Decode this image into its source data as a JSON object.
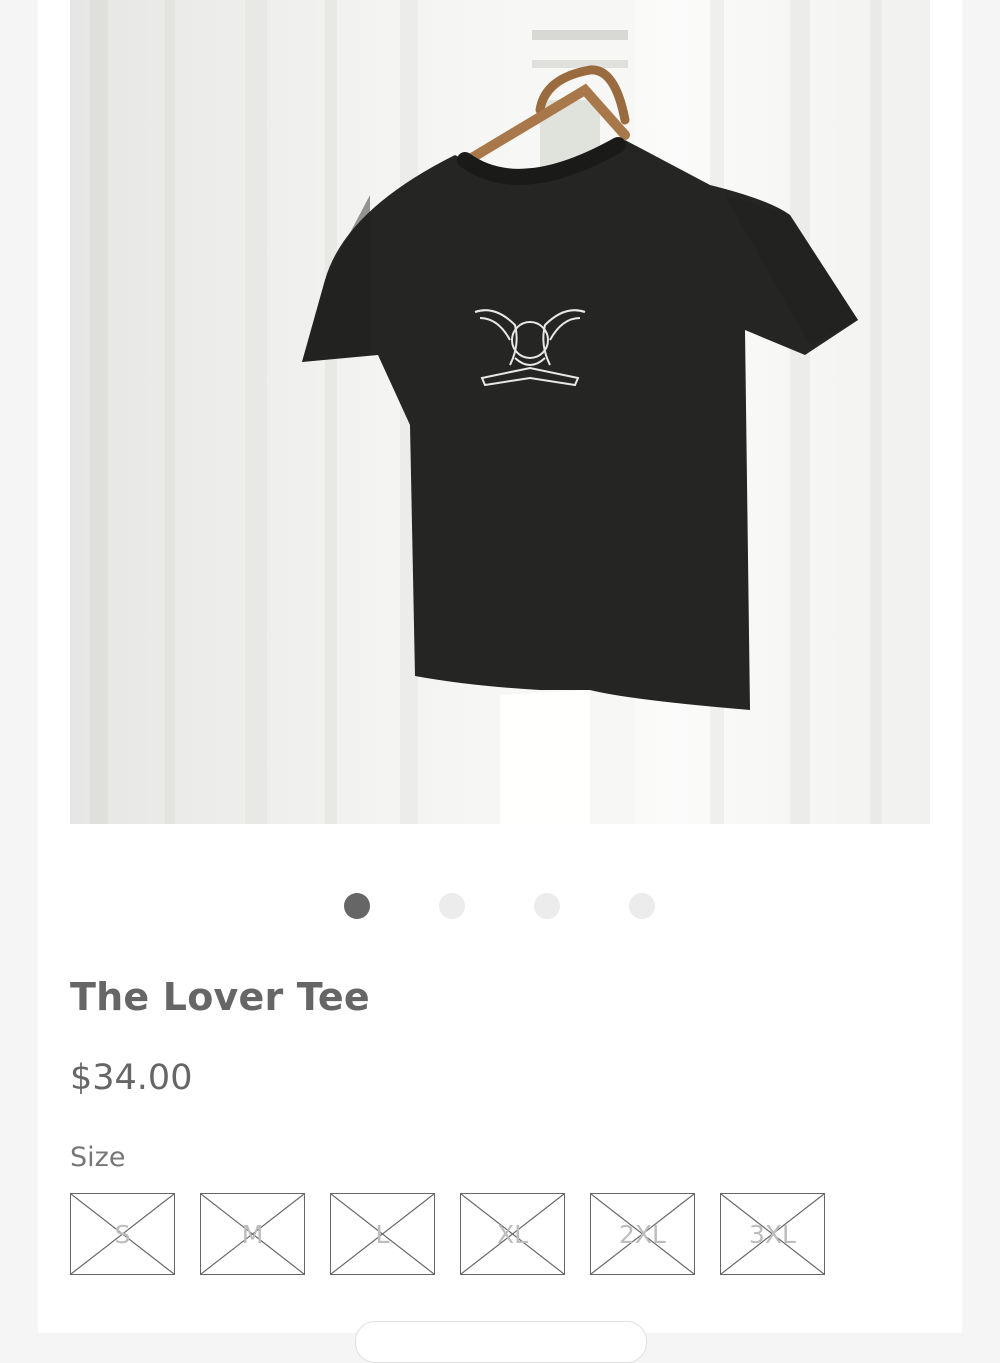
{
  "product": {
    "title": "The Lover Tee",
    "price": "$34.00",
    "image_alt": "t-shirt-photo"
  },
  "carousel": {
    "count": 4,
    "active_index": 0
  },
  "size_selector": {
    "label": "Size",
    "options": [
      {
        "label": "S",
        "available": false
      },
      {
        "label": "M",
        "available": false
      },
      {
        "label": "L",
        "available": false
      },
      {
        "label": "XL",
        "available": false
      },
      {
        "label": "2XL",
        "available": false
      },
      {
        "label": "3XL",
        "available": false
      }
    ]
  },
  "colors": {
    "text": "#666666",
    "dot_active": "#666666",
    "dot_inactive": "#ececec",
    "shirt": "#252524"
  }
}
